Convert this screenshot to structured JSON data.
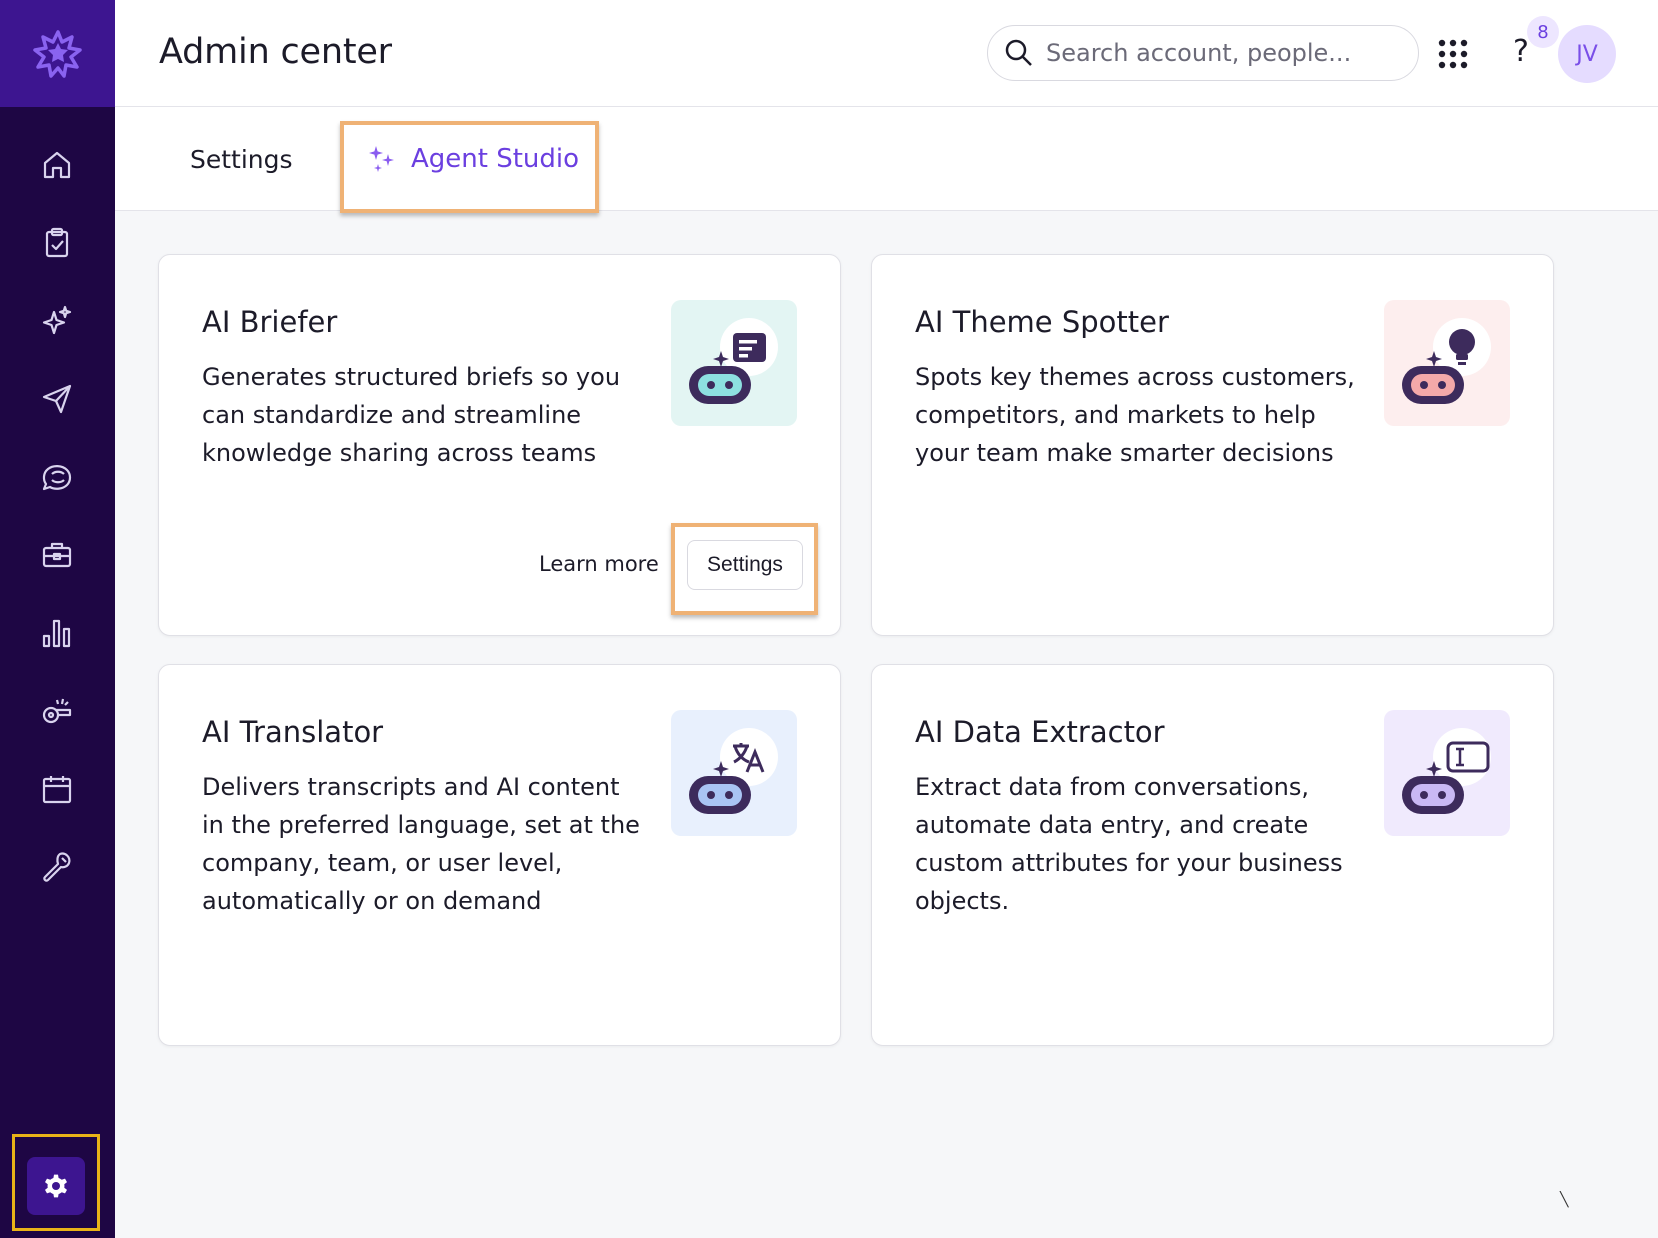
{
  "header": {
    "title": "Admin center",
    "search_placeholder": "Search account, people...",
    "notification_count": "8",
    "help_label": "?",
    "avatar_initials": "JV"
  },
  "tabs": [
    {
      "label": "Settings",
      "active": false
    },
    {
      "label": "Agent Studio",
      "active": true
    }
  ],
  "sidebar": {
    "items": [
      "home-icon",
      "clipboard-check-icon",
      "sparkle-icon",
      "send-icon",
      "chat-bubbles-icon",
      "briefcase-icon",
      "bar-chart-icon",
      "whistle-icon",
      "calendar-icon",
      "wrench-icon"
    ],
    "bottom": "gear-icon"
  },
  "cards": [
    {
      "title": "AI Briefer",
      "description": "Generates structured briefs so you can standardize and streamline knowledge sharing across teams",
      "learn_more": "Learn more",
      "settings": "Settings",
      "icon": "robot-brief-icon",
      "bg": "#e3f5f3"
    },
    {
      "title": "AI Theme Spotter",
      "description": "Spots key themes across customers, competitors, and markets to help your team make smarter decisions",
      "icon": "robot-lightbulb-icon",
      "bg": "#fdeeee"
    },
    {
      "title": "AI Translator",
      "description": "Delivers transcripts and AI content in the preferred language, set at the company, team, or user level, automatically or on demand",
      "icon": "robot-translate-icon",
      "bg": "#e8f0fd"
    },
    {
      "title": "AI Data Extractor",
      "description": "Extract data from conversations, automate data entry, and create custom attributes for your business objects.",
      "icon": "robot-input-icon",
      "bg": "#f0eafd"
    }
  ],
  "colors": {
    "sidebar": "#1e0644",
    "accent": "#6b3fe0",
    "highlight_orange": "#efb275",
    "highlight_yellow": "#e9b318"
  }
}
